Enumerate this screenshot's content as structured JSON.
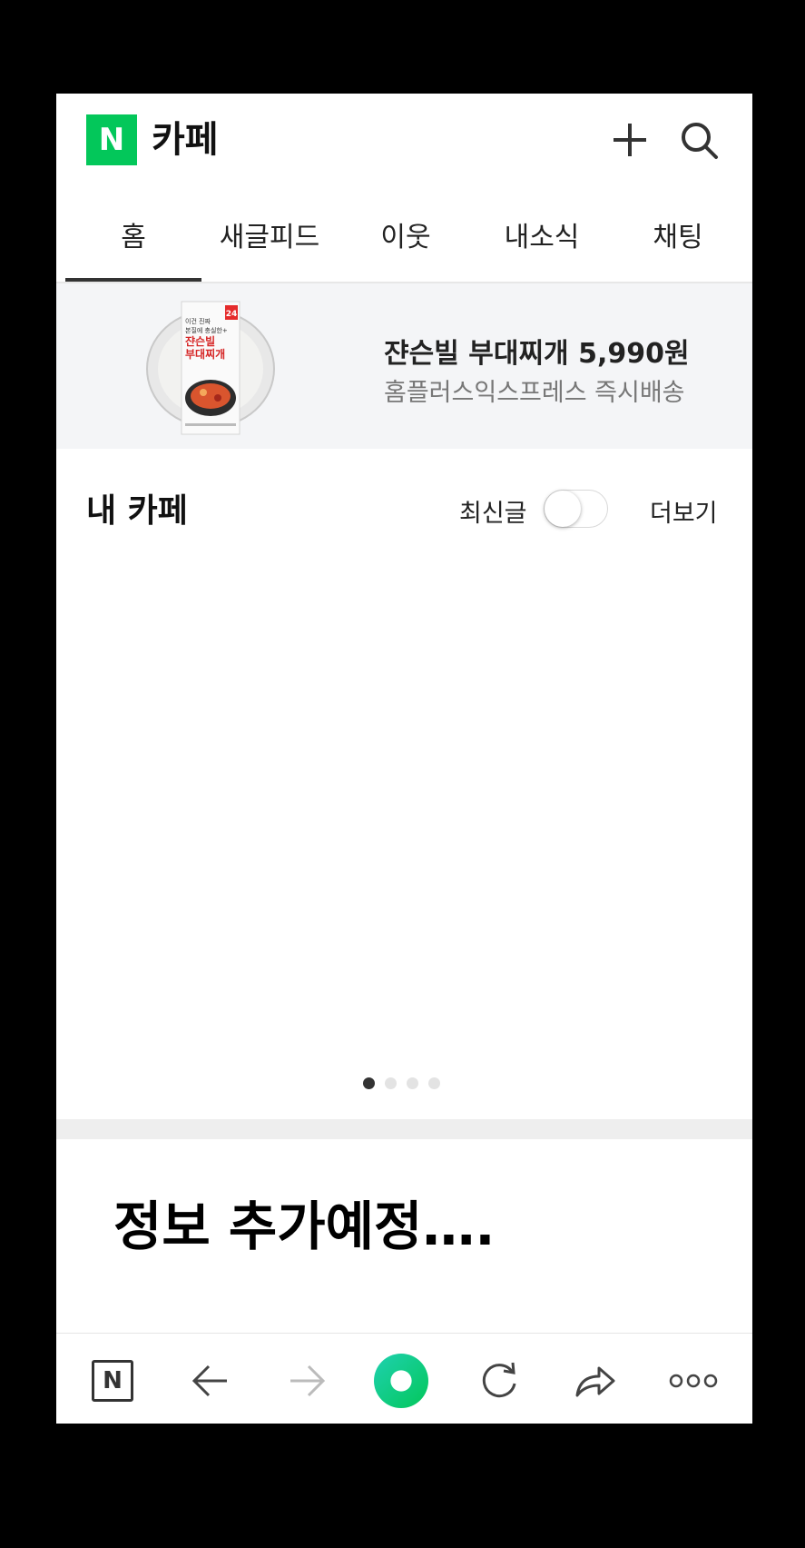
{
  "header": {
    "logo_letter": "N",
    "title": "카페",
    "add_icon": "plus-icon",
    "search_icon": "search-icon"
  },
  "tabs": [
    {
      "label": "홈",
      "active": true
    },
    {
      "label": "새글피드",
      "active": false
    },
    {
      "label": "이웃",
      "active": false
    },
    {
      "label": "내소식",
      "active": false
    },
    {
      "label": "채팅",
      "active": false
    }
  ],
  "banner": {
    "badge": "24",
    "product_lines": [
      "이건 진짜",
      "본질에 충실한+",
      "쟌슨빌",
      "부대찌개"
    ],
    "title": "쟌슨빌 부대찌개 5,990원",
    "subtitle": "홈플러스익스프레스 즉시배송"
  },
  "my_cafe": {
    "title": "내 카페",
    "latest_label": "최신글",
    "latest_toggle_on": false,
    "more_label": "더보기",
    "page_count": 4,
    "active_page": 1
  },
  "info": {
    "text": "정보 추가예정…."
  },
  "bottom_bar": {
    "home_letter": "N",
    "icons": [
      "naver-home-icon",
      "back-arrow-icon",
      "forward-arrow-icon",
      "green-dot-icon",
      "refresh-icon",
      "share-icon",
      "more-icon"
    ]
  },
  "colors": {
    "brand_green": "#03c75a",
    "accent_teal": "#1fd1b0"
  }
}
